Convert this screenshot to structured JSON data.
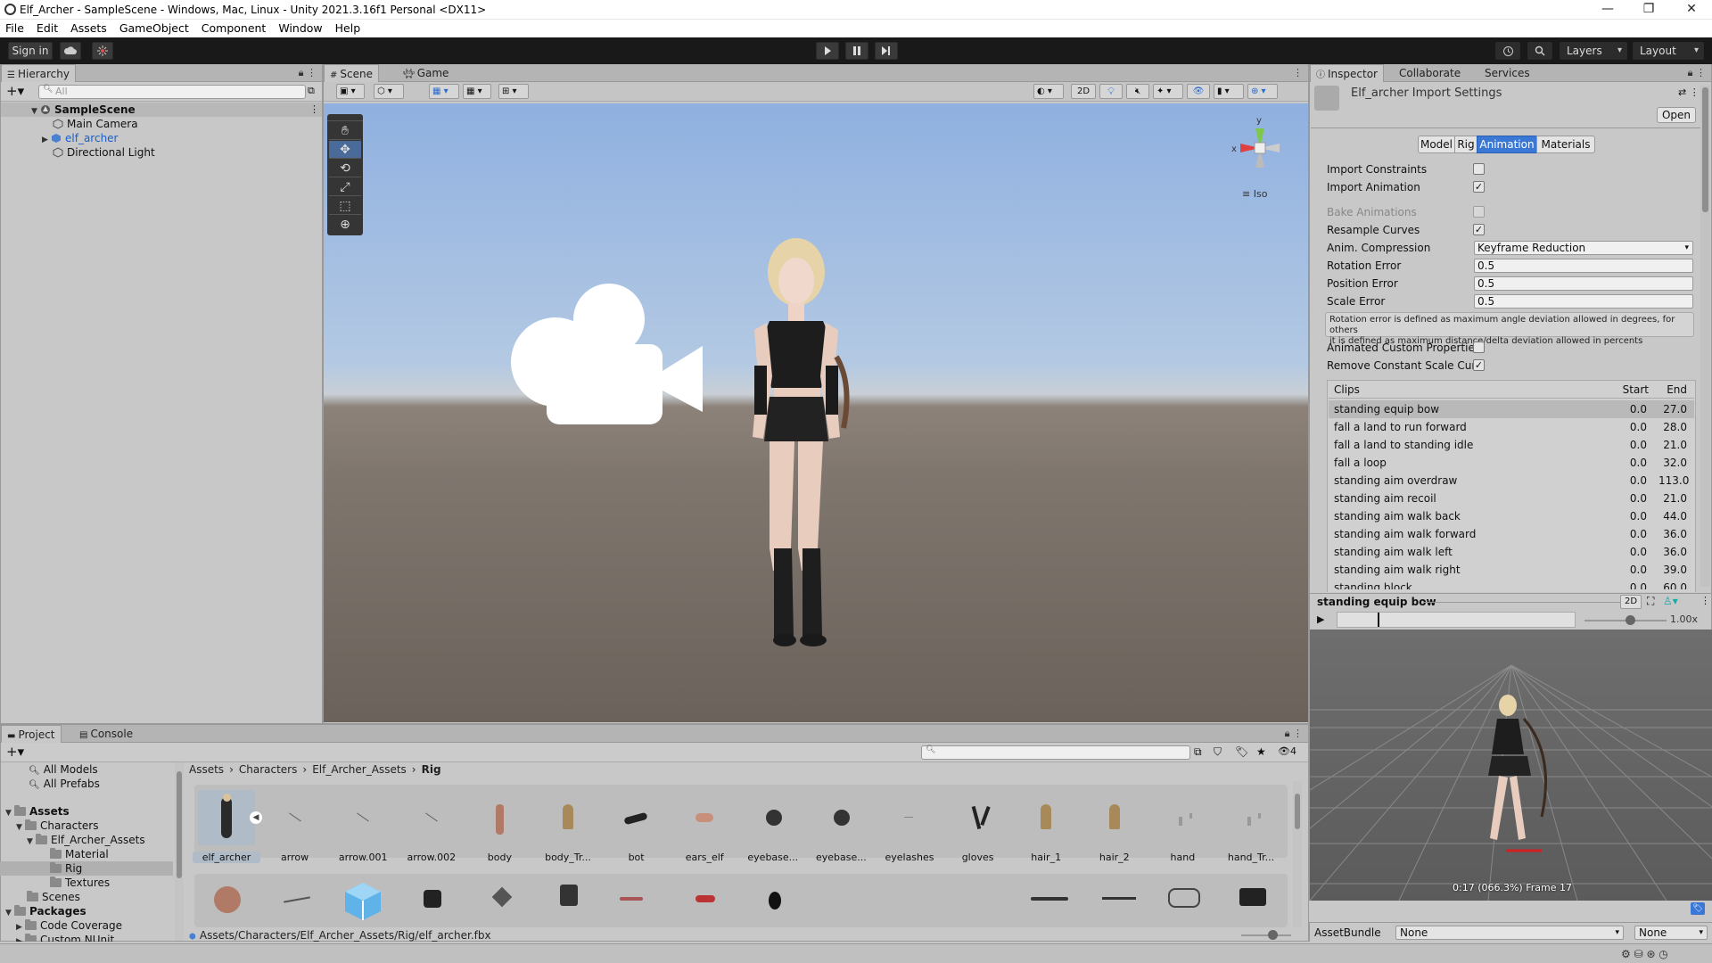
{
  "window": {
    "title": "Elf_Archer - SampleScene - Windows, Mac, Linux - Unity 2021.3.16f1 Personal <DX11>",
    "minimize": "—",
    "maximize": "❐",
    "close": "✕"
  },
  "menu": [
    "File",
    "Edit",
    "Assets",
    "GameObject",
    "Component",
    "Window",
    "Help"
  ],
  "toolbar": {
    "signin": "Sign in",
    "cloud_icon": "cloud-icon",
    "collab_icon": "collab-icon",
    "play_icon": "play-icon",
    "pause_icon": "pause-icon",
    "step_icon": "step-icon",
    "history_icon": "history-icon",
    "search_icon": "search-icon",
    "layers": "Layers",
    "layout": "Layout"
  },
  "hierarchy": {
    "tab": "Hierarchy",
    "search_placeholder": "All",
    "scene": "SampleScene",
    "items": [
      "Main Camera",
      "elf_archer",
      "Directional Light"
    ]
  },
  "scene_view": {
    "tabs": [
      "Scene",
      "Game"
    ],
    "mode_2d": "2D",
    "iso": "Iso",
    "gizmo_x": "x",
    "gizmo_y": "y"
  },
  "inspector": {
    "tabs": [
      "Inspector",
      "Collaborate",
      "Services"
    ],
    "title": "Elf_archer Import Settings",
    "open": "Open",
    "subtabs": [
      "Model",
      "Rig",
      "Animation",
      "Materials"
    ],
    "active_subtab": "Animation",
    "rows": {
      "import_constraints": "Import Constraints",
      "import_animation": "Import Animation",
      "bake_animations": "Bake Animations",
      "resample_curves": "Resample Curves",
      "anim_compression": "Anim. Compression",
      "rotation_error": "Rotation Error",
      "position_error": "Position Error",
      "scale_error": "Scale Error",
      "animated_custom": "Animated Custom Properties",
      "remove_constant": "Remove Constant Scale Curv"
    },
    "values": {
      "import_constraints": false,
      "import_animation": true,
      "bake_animations": false,
      "resample_curves": true,
      "anim_compression": "Keyframe Reduction",
      "rotation_error": "0.5",
      "position_error": "0.5",
      "scale_error": "0.5",
      "animated_custom": false,
      "remove_constant": true
    },
    "help_line1": "Rotation error is defined as maximum angle deviation allowed in degrees, for others",
    "help_line2": "it is defined as maximum distance/delta deviation allowed in percents",
    "clips_header": {
      "name": "Clips",
      "start": "Start",
      "end": "End"
    },
    "clips": [
      {
        "name": "standing equip bow",
        "start": "0.0",
        "end": "27.0"
      },
      {
        "name": "fall a land to run forward",
        "start": "0.0",
        "end": "28.0"
      },
      {
        "name": "fall a land to standing idle",
        "start": "0.0",
        "end": "21.0"
      },
      {
        "name": "fall a loop",
        "start": "0.0",
        "end": "32.0"
      },
      {
        "name": "standing aim overdraw",
        "start": "0.0",
        "end": "113.0"
      },
      {
        "name": "standing aim recoil",
        "start": "0.0",
        "end": "21.0"
      },
      {
        "name": "standing aim walk back",
        "start": "0.0",
        "end": "44.0"
      },
      {
        "name": "standing aim walk forward",
        "start": "0.0",
        "end": "36.0"
      },
      {
        "name": "standing aim walk left",
        "start": "0.0",
        "end": "36.0"
      },
      {
        "name": "standing aim walk right",
        "start": "0.0",
        "end": "39.0"
      },
      {
        "name": "standing block",
        "start": "0.0",
        "end": "60.0"
      }
    ],
    "preview": {
      "clip": "standing equip bow",
      "mode": "2D",
      "speed": "1.00x",
      "time_fraction": 0.17,
      "frame_text": "0:17 (066.3%) Frame 17"
    },
    "assetbundle": {
      "label": "AssetBundle",
      "value": "None",
      "variant": "None"
    }
  },
  "project": {
    "tabs": [
      "Project",
      "Console"
    ],
    "favorites": [
      "All Models",
      "All Prefabs"
    ],
    "tree": {
      "assets": "Assets",
      "characters": "Characters",
      "elf_archer_assets": "Elf_Archer_Assets",
      "material": "Material",
      "rig": "Rig",
      "textures": "Textures",
      "scenes": "Scenes",
      "packages": "Packages",
      "code_coverage": "Code Coverage",
      "custom_nunit": "Custom NUnit"
    },
    "breadcrumb": [
      "Assets",
      "Characters",
      "Elf_Archer_Assets",
      "Rig"
    ],
    "hidden_count": "4",
    "assets": [
      "elf_archer",
      "arrow",
      "arrow.001",
      "arrow.002",
      "body",
      "body_Tr...",
      "bot",
      "ears_elf",
      "eyebase...",
      "eyebase...",
      "eyelashes",
      "gloves",
      "hair_1",
      "hair_2",
      "hand",
      "hand_Tr..."
    ],
    "status_path": "Assets/Characters/Elf_Archer_Assets/Rig/elf_archer.fbx"
  }
}
